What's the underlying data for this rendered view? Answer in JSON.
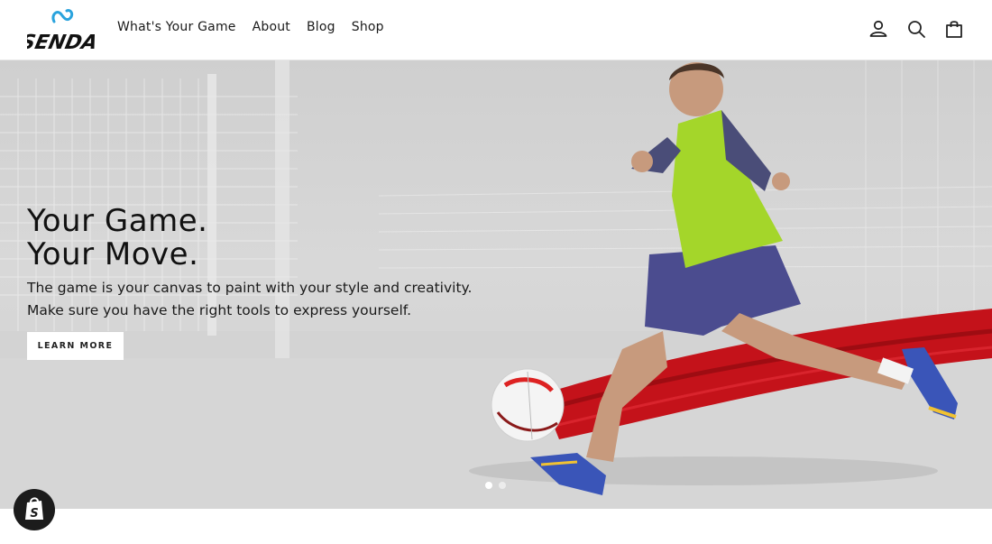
{
  "brand": {
    "logo_text": "SENDA",
    "accent_color": "#2aa3dd"
  },
  "nav": {
    "items": [
      {
        "label": "What's Your Game"
      },
      {
        "label": "About"
      },
      {
        "label": "Blog"
      },
      {
        "label": "Shop"
      }
    ]
  },
  "header_icons": [
    "account-icon",
    "search-icon",
    "cart-icon"
  ],
  "hero": {
    "title_line1": "Your Game.",
    "title_line2": "Your Move.",
    "subtitle": "The game is your canvas to paint with your style and creativity. Make sure you have the right tools to express yourself.",
    "cta_label": "LEARN MORE",
    "slides_total": 2,
    "slide_active": 1
  },
  "colors": {
    "paint_red": "#c4121a",
    "bib_green": "#a4d62a"
  }
}
